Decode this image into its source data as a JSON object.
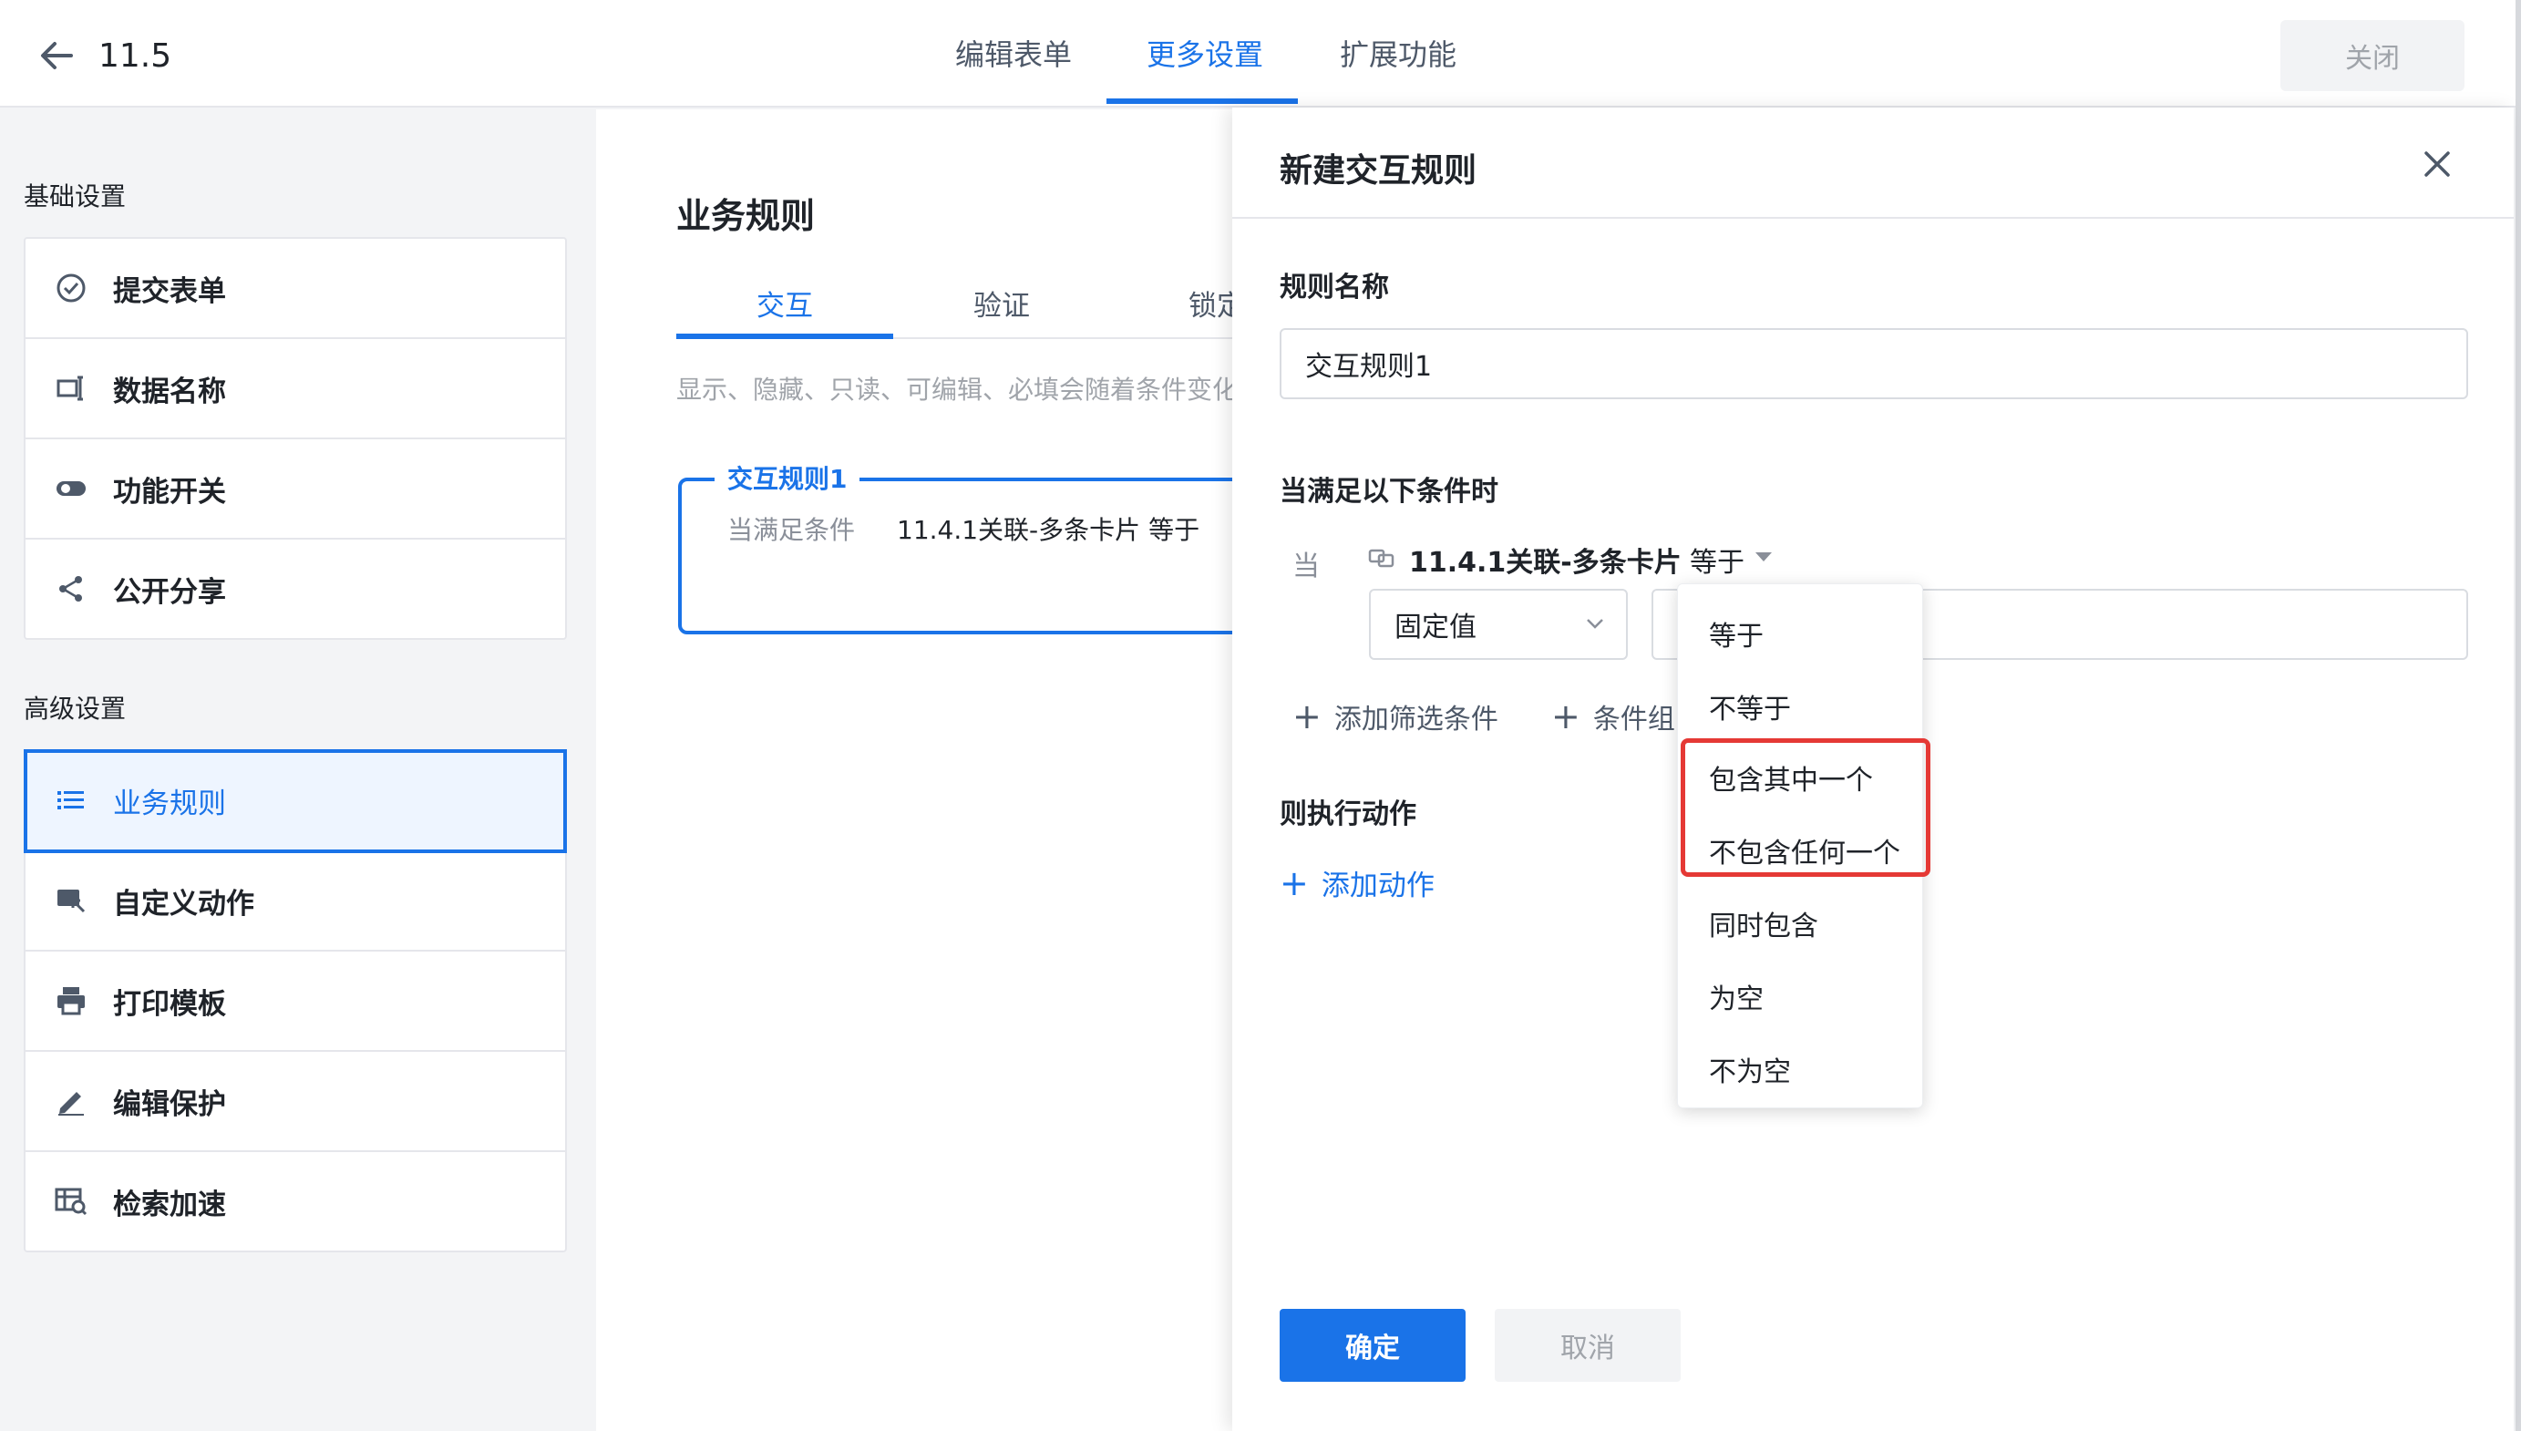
{
  "header": {
    "back_icon": "arrow-left-icon",
    "title": "11.5",
    "tabs": [
      {
        "label": "编辑表单",
        "active": false
      },
      {
        "label": "更多设置",
        "active": true
      },
      {
        "label": "扩展功能",
        "active": false
      }
    ],
    "close_label": "关闭",
    "accent_color": "#1a73e8"
  },
  "sidebar": {
    "basic_title": "基础设置",
    "basic_items": [
      {
        "label": "提交表单",
        "icon": "check-circle-icon"
      },
      {
        "label": "数据名称",
        "icon": "label-icon"
      },
      {
        "label": "功能开关",
        "icon": "toggle-icon"
      },
      {
        "label": "公开分享",
        "icon": "share-icon"
      }
    ],
    "advanced_title": "高级设置",
    "advanced_items": [
      {
        "label": "业务规则",
        "icon": "list-icon",
        "active": true
      },
      {
        "label": "自定义动作",
        "icon": "cursor-action-icon",
        "active": false
      },
      {
        "label": "打印模板",
        "icon": "printer-icon",
        "active": false
      },
      {
        "label": "编辑保护",
        "icon": "pen-icon",
        "active": false
      },
      {
        "label": "检索加速",
        "icon": "search-table-icon",
        "active": false
      }
    ]
  },
  "main": {
    "title": "业务规则",
    "tabs": [
      {
        "label": "交互",
        "active": true
      },
      {
        "label": "验证",
        "active": false
      },
      {
        "label": "锁定",
        "active": false
      }
    ],
    "description": "显示、隐藏、只读、可编辑、必填会随着条件变化",
    "rule_card": {
      "title": "交互规则1",
      "condition_label": "当满足条件",
      "condition_value": "11.4.1关联-多条卡片  等于"
    }
  },
  "drawer": {
    "title": "新建交互规则",
    "close_icon": "close-icon",
    "rule_name_label": "规则名称",
    "rule_name_value": "交互规则1",
    "conditions_label": "当满足以下条件时",
    "when_label": "当",
    "condition_field": "11.4.1关联-多条卡片",
    "operator_value": "等于",
    "value_type": "固定值",
    "add_filter_label": "添加筛选条件",
    "add_group_label": "条件组",
    "actions_label": "则执行动作",
    "add_action_label": "添加动作",
    "confirm_label": "确定",
    "cancel_label": "取消"
  },
  "operator_dropdown": {
    "options": [
      "等于",
      "不等于",
      "包含其中一个",
      "不包含任何一个",
      "同时包含",
      "为空",
      "不为空"
    ],
    "highlighted": [
      "包含其中一个",
      "不包含任何一个"
    ],
    "highlight_color": "#e53935"
  }
}
